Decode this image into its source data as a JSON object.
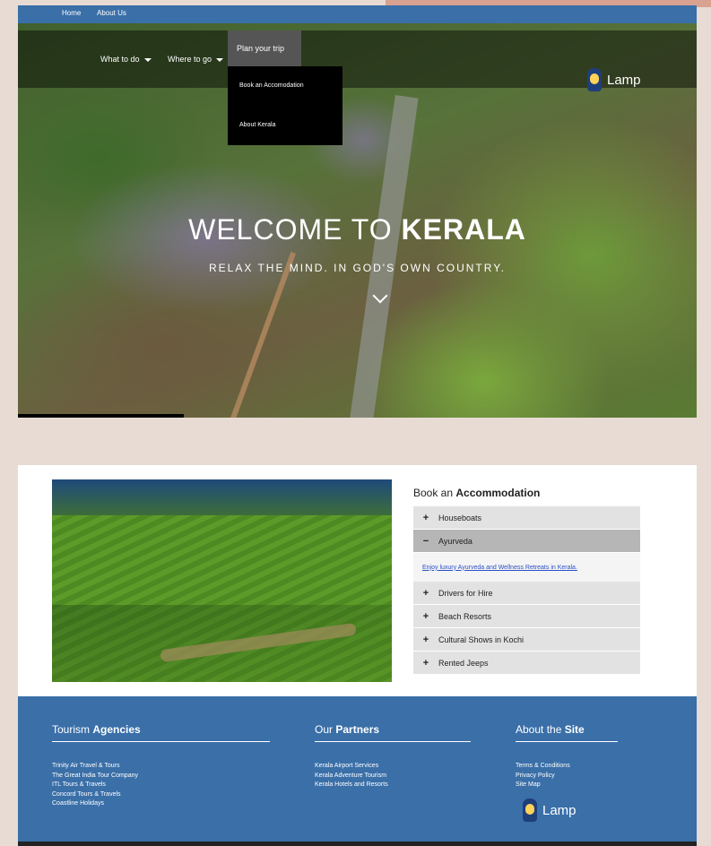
{
  "topbar": {
    "home": "Home",
    "about": "About Us"
  },
  "nav": {
    "items": [
      "What to do",
      "Where to go",
      "Plan your trip"
    ],
    "dropdown": [
      "Book an Accomodation",
      "About Kerala"
    ]
  },
  "logo": {
    "text": "Lamp"
  },
  "hero": {
    "title_light": "WELCOME TO ",
    "title_bold": "KERALA",
    "subtitle": "RELAX THE MIND. IN GOD'S OWN COUNTRY."
  },
  "booking": {
    "title_light": "Book an ",
    "title_bold": "Accommodation",
    "items": [
      "Houseboats",
      "Ayurveda",
      "Drivers for Hire",
      "Beach Resorts",
      "Cultural Shows in Kochi",
      "Rented Jeeps"
    ],
    "open_item": "Ayurveda",
    "open_link": "Enjoy luxury Ayurveda and Wellness Retreats in Kerala.",
    "plus": "+",
    "minus": "−"
  },
  "footer": {
    "agencies": {
      "title_light": "Tourism ",
      "title_bold": "Agencies",
      "items": [
        "Trinity Air Travel & Tours",
        "The Great India Tour Company",
        "ITL Tours & Travels",
        "Concord Tours & Travels",
        "Coastline Holidays"
      ]
    },
    "partners": {
      "title_light": "Our ",
      "title_bold": "Partners",
      "items": [
        "Kerala Airport Services",
        "Kerala Adventure Tourism",
        "Kerala Hotels and Resorts"
      ]
    },
    "site": {
      "title_light": "About the ",
      "title_bold": "Site",
      "items": [
        "Terms & Conditions",
        "Privacy Policy",
        "Site Map"
      ]
    }
  },
  "colors": {
    "nav_blue": "#3a6fa8",
    "background": "#e7dbd4",
    "accordion_open": "#b6b6b6",
    "accordion": "#e2e2e2"
  },
  "icons": [
    "caret-down-icon",
    "chevron-down-icon",
    "lamp-logo-icon",
    "plus-icon",
    "minus-icon"
  ]
}
